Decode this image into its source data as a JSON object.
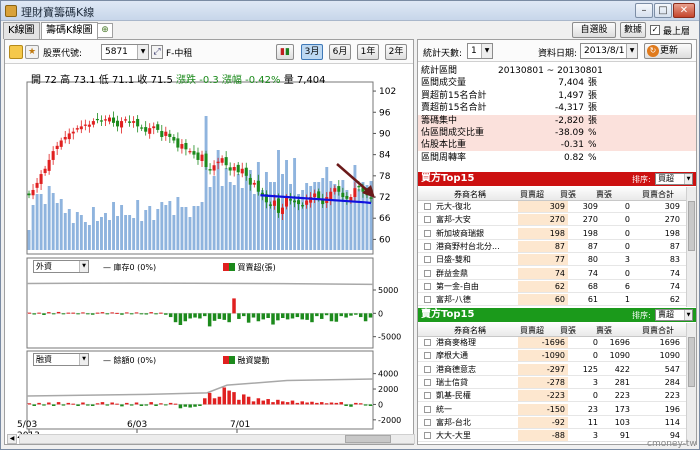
{
  "window": {
    "title": "理財寶籌碼K線"
  },
  "tabs": [
    {
      "label": "K線圖"
    },
    {
      "label": "籌碼K線圖"
    }
  ],
  "top_buttons": {
    "custom": "自選股",
    "data": "數據",
    "topmost": "最上層"
  },
  "toolbar": {
    "stock_label": "股票代號:",
    "stock_code": "5871",
    "stock_name": "F-中租",
    "periods": [
      "3月",
      "6月",
      "1年",
      "2年"
    ],
    "active_period": "3月"
  },
  "ohlc": {
    "open_label": "開",
    "open": "72",
    "high_label": "高",
    "high": "73.1",
    "low_label": "低",
    "low": "71.1",
    "close_label": "收",
    "close": "71.5",
    "change_label": "漲跌",
    "change": "-0.3",
    "pct_label": "漲幅",
    "pct": "-0.42%",
    "vol_label": "量",
    "vol": "7,404"
  },
  "panel2": {
    "select": "外資",
    "legend1": "— 庫存0 (0%)",
    "legend2": "買賣超(張)"
  },
  "panel3": {
    "select": "融資",
    "legend1": "— 餘額0 (0%)",
    "legend2": "融資變動"
  },
  "x_labels": [
    "5/03",
    "6/03",
    "7/01"
  ],
  "x_year": "2013",
  "axis": {
    "price": [
      "102",
      "96",
      "90",
      "84",
      "78",
      "72",
      "66",
      "60"
    ],
    "foreign": [
      "5000",
      "0",
      "-5000"
    ],
    "margin": [
      "4000",
      "2000",
      "0",
      "-2000"
    ]
  },
  "chart_data": [
    {
      "type": "candlestick",
      "title": "",
      "ylim": [
        57,
        104
      ],
      "series": [
        {
          "values": [
            72.5,
            74.0,
            76.0,
            78.5,
            80.0,
            82.5,
            85.0,
            86.5,
            88.0,
            89.0,
            90.0,
            90.5,
            91.5,
            92.0,
            92.5,
            92.5,
            93.5,
            94.0,
            93.5,
            94.0,
            94.5,
            93.0,
            92.0,
            93.5,
            94.0,
            93.0,
            93.5,
            92.0,
            91.5,
            90.5,
            91.5,
            92.0,
            91.0,
            89.0,
            90.5,
            89.0,
            88.0,
            86.0,
            87.0,
            85.5,
            85.0,
            84.0,
            82.5,
            84.0,
            80.5,
            79.5,
            81.0,
            82.0,
            83.0,
            81.0,
            79.5,
            80.5,
            79.0,
            80.0,
            78.0,
            75.5,
            76.0,
            73.5,
            72.5,
            70.5,
            69.5,
            71.0,
            67.5,
            69.0,
            72.0,
            71.0,
            70.5,
            70.0,
            69.5,
            71.0,
            72.0,
            73.0,
            71.5,
            70.0,
            72.0,
            73.5,
            74.5,
            73.5,
            72.0,
            71.5,
            72.0,
            74.5,
            75.0,
            73.5,
            72.5,
            71.5
          ]
        }
      ]
    },
    {
      "type": "bar",
      "title": "外資買賣超",
      "ylim": [
        -7000,
        8000
      ],
      "values": [
        150,
        -250,
        150,
        -350,
        250,
        -200,
        300,
        -150,
        150,
        150,
        -200,
        200,
        -100,
        -300,
        150,
        250,
        -150,
        200,
        100,
        -300,
        200,
        -100,
        200,
        -150,
        -250,
        250,
        -150,
        150,
        -300,
        -800,
        -1900,
        -2500,
        -1700,
        -1100,
        -900,
        -1100,
        -600,
        -2800,
        -1600,
        -1200,
        -1400,
        -1900,
        3200,
        -1200,
        -600,
        -2000,
        -900,
        -1700,
        -1300,
        -1000,
        -2400,
        -1500,
        -1000,
        -1300,
        -1100,
        -800,
        -1300,
        -1400,
        -1900,
        -600,
        -1200,
        -400,
        -1700,
        -1800,
        -600,
        -900,
        -500,
        -300,
        -800,
        -1700,
        -900
      ]
    },
    {
      "type": "bar",
      "title": "融資變動",
      "ylim": [
        -2800,
        4600
      ],
      "values": [
        150,
        -200,
        200,
        -150,
        250,
        -200,
        300,
        -150,
        200,
        100,
        -200,
        250,
        -150,
        -200,
        150,
        300,
        -150,
        250,
        100,
        -250,
        200,
        -150,
        250,
        -200,
        -150,
        300,
        -200,
        150,
        -100,
        200,
        100,
        -500,
        -300,
        -400,
        -300,
        -200,
        800,
        1500,
        800,
        1000,
        2200,
        1800,
        1600,
        600,
        1300,
        1000,
        400,
        800,
        500,
        700,
        300,
        600,
        400,
        300,
        500,
        200,
        400,
        250,
        350,
        200,
        300,
        150,
        250,
        200,
        300,
        -200,
        -300,
        200,
        150,
        -150,
        -200
      ]
    }
  ],
  "right": {
    "stat_days_label": "統計天數:",
    "stat_days": "1",
    "date_label": "資料日期:",
    "date": "2013/8/1",
    "refresh": "更新",
    "stats": [
      {
        "k": "統計區間",
        "v": "20130801 ~ 20130801",
        "u": "",
        "pink": false,
        "full": true
      },
      {
        "k": "區間成交量",
        "v": "7,404",
        "u": "張",
        "pink": false
      },
      {
        "k": "買超前15名合計",
        "v": "1,497",
        "u": "張",
        "pink": false
      },
      {
        "k": "賣超前15名合計",
        "v": "-4,317",
        "u": "張",
        "pink": false
      },
      {
        "k": "籌碼集中",
        "v": "-2,820",
        "u": "張",
        "pink": true
      },
      {
        "k": "佔區間成交比重",
        "v": "-38.09",
        "u": "%",
        "pink": true
      },
      {
        "k": "佔股本比重",
        "v": "-0.31",
        "u": "%",
        "pink": true
      },
      {
        "k": "區間周轉率",
        "v": "0.82",
        "u": "%",
        "pink": false
      }
    ],
    "buy_title": "買方Top15",
    "sell_title": "賣方Top15",
    "sort_label": "排序:",
    "buy_sort": "買超",
    "sell_sort": "賣超",
    "headers": [
      "券商名稱",
      "買賣超",
      "買張",
      "賣張",
      "買賣合計"
    ],
    "buy_rows": [
      [
        "元大-復北",
        "309",
        "309",
        "0",
        "309"
      ],
      [
        "富邦-大安",
        "270",
        "270",
        "0",
        "270"
      ],
      [
        "新加坡商瑞銀",
        "198",
        "198",
        "0",
        "198"
      ],
      [
        "港商野村台北分...",
        "87",
        "87",
        "0",
        "87"
      ],
      [
        "日盛-雙和",
        "77",
        "80",
        "3",
        "83"
      ],
      [
        "群益金鼎",
        "74",
        "74",
        "0",
        "74"
      ],
      [
        "第一金-自由",
        "62",
        "68",
        "6",
        "74"
      ],
      [
        "富邦-八德",
        "60",
        "61",
        "1",
        "62"
      ]
    ],
    "sell_rows": [
      [
        "港商麥格理",
        "-1696",
        "0",
        "1696",
        "1696"
      ],
      [
        "摩根大通",
        "-1090",
        "0",
        "1090",
        "1090"
      ],
      [
        "港商德意志",
        "-297",
        "125",
        "422",
        "547"
      ],
      [
        "瑞士信貸",
        "-278",
        "3",
        "281",
        "284"
      ],
      [
        "凱基-民權",
        "-223",
        "0",
        "223",
        "223"
      ],
      [
        "統一",
        "-150",
        "23",
        "173",
        "196"
      ],
      [
        "富邦-台北",
        "-92",
        "11",
        "103",
        "114"
      ],
      [
        "大大-大里",
        "-88",
        "3",
        "91",
        "94"
      ]
    ]
  },
  "watermark": "cmoney-tw",
  "colors": {
    "up": "#e02020",
    "down": "#1c8a1c",
    "vol": "#8fb4de",
    "trend": "#1010e0",
    "arrow": "#6b1a1a",
    "buy_head": "#cc1010",
    "sell_head": "#1b9a1b"
  }
}
